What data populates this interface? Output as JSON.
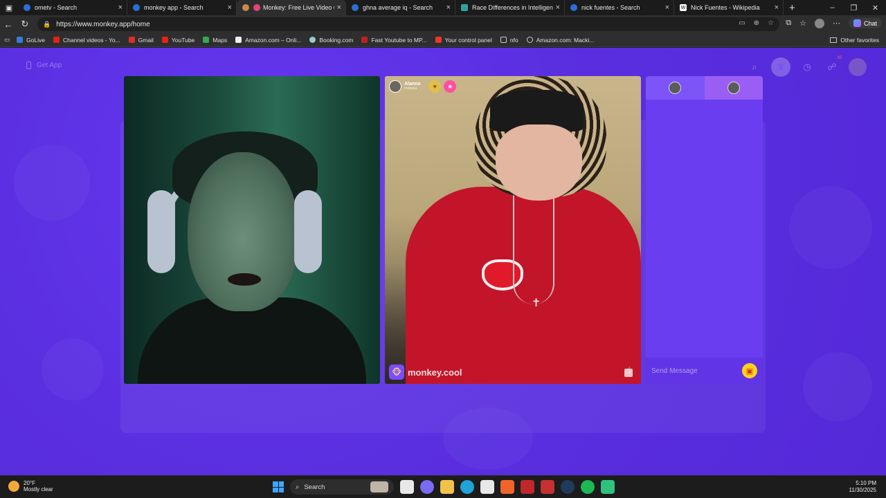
{
  "browser": {
    "tabs": [
      {
        "title": "ometv - Search",
        "active": false,
        "color": "#2b6fd6"
      },
      {
        "title": "monkey app - Search",
        "active": false,
        "color": "#2b6fd6"
      },
      {
        "title": "Monkey: Free Live Video Ch",
        "active": true,
        "color": "#c98a4a"
      },
      {
        "title": "ghna average iq - Search",
        "active": false,
        "color": "#2b6fd6"
      },
      {
        "title": "Race Differences in Intelligence",
        "active": false,
        "color": "#2ea39c"
      },
      {
        "title": "nick fuentes - Search",
        "active": false,
        "color": "#2b6fd6"
      },
      {
        "title": "Nick Fuentes - Wikipedia",
        "active": false,
        "color": "#ffffff"
      }
    ],
    "new_tab_icon": "plus-icon",
    "url": "https://www.monkey.app/home",
    "chat_label": "Chat",
    "bookmarks": [
      {
        "label": "GoLive",
        "color": "#3a7bd5"
      },
      {
        "label": "Channel videos - Yo...",
        "color": "#e62117"
      },
      {
        "label": "Gmail",
        "color": "#d93025"
      },
      {
        "label": "YouTube",
        "color": "#e62117"
      },
      {
        "label": "Maps",
        "color": "#34a853"
      },
      {
        "label": "Amazon.com – Onli...",
        "color": "#f0f0f0"
      },
      {
        "label": "Booking.com",
        "color": "#9cc"
      },
      {
        "label": "Fast Youtube to MP...",
        "color": "#b22"
      },
      {
        "label": "Your control panel",
        "color": "#e33"
      },
      {
        "label": "nfo",
        "color": "#888"
      },
      {
        "label": "Amazon.com: Macki...",
        "color": "#999"
      }
    ],
    "other_favorites": "Other favorites"
  },
  "page": {
    "get_app": "Get App",
    "notification_count": "10",
    "accent": "#5a2fe0",
    "remote_user": {
      "name": "Alanna",
      "location": "Indiana"
    },
    "watermark": "monkey.cool",
    "chat_placeholder": "Send Message"
  },
  "taskbar": {
    "temperature": "20°F",
    "weather": "Mostly clear",
    "search_label": "Search",
    "time": "5:10 PM",
    "date": "11/30/2025",
    "apps": [
      {
        "name": "task-view-icon",
        "color": "#e8e8e8"
      },
      {
        "name": "copilot-icon",
        "color": "#7a6cf0"
      },
      {
        "name": "file-explorer-icon",
        "color": "#f2c14a"
      },
      {
        "name": "edge-icon",
        "color": "#1fa3d6"
      },
      {
        "name": "store-icon",
        "color": "#e8e8e8"
      },
      {
        "name": "brave-icon",
        "color": "#f0642a"
      },
      {
        "name": "filezilla-icon",
        "color": "#c0262c"
      },
      {
        "name": "app-4-icon",
        "color": "#c53030"
      },
      {
        "name": "steam-icon",
        "color": "#1f3b5a"
      },
      {
        "name": "spotify-icon",
        "color": "#1db954"
      },
      {
        "name": "green-app-icon",
        "color": "#2ec27e"
      }
    ]
  }
}
